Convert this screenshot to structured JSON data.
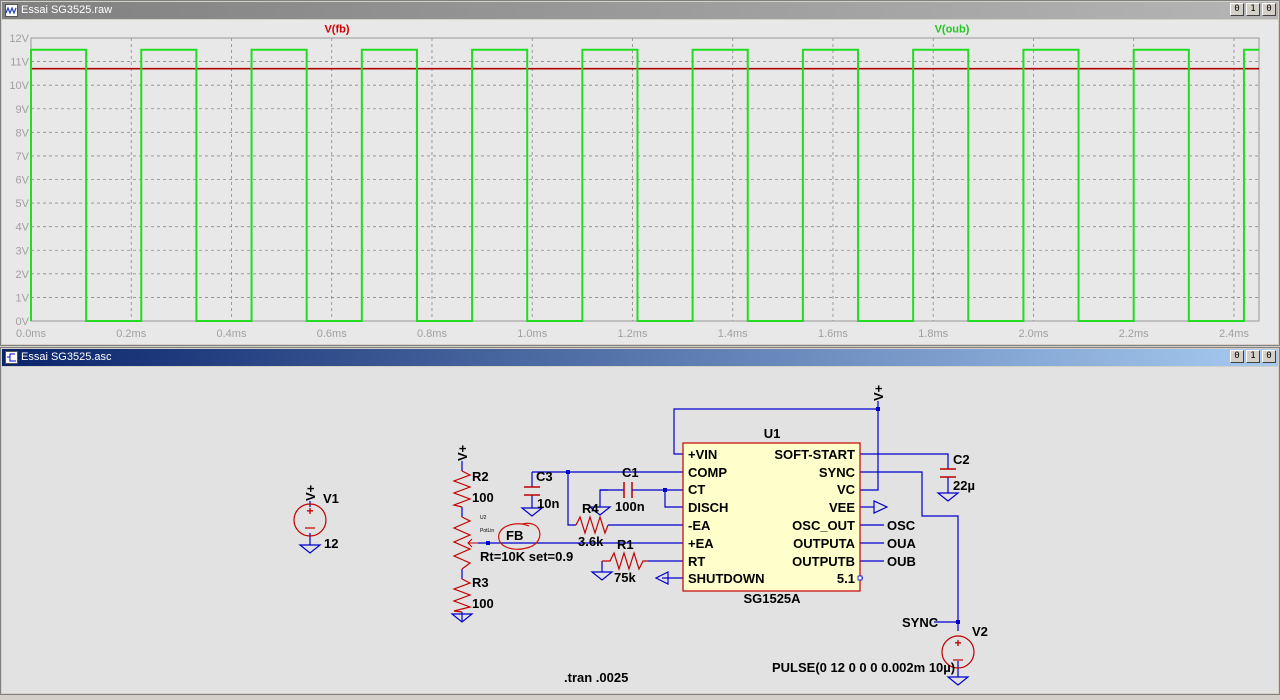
{
  "plot_window": {
    "title": "Essai SG3525.raw",
    "buttons": [
      "0",
      "1",
      "0"
    ],
    "trace_labels": [
      {
        "name": "V(fb)",
        "color": "#d00000"
      },
      {
        "name": "V(oub)",
        "color": "#21dc21"
      }
    ]
  },
  "chart_data": {
    "type": "line",
    "title": "",
    "xlabel": "",
    "ylabel": "",
    "xlim": [
      0.0,
      2.45
    ],
    "x_unit": "ms",
    "ylim": [
      0,
      12
    ],
    "y_unit": "V",
    "grid": true,
    "x_ticks": [
      "0.0ms",
      "0.2ms",
      "0.4ms",
      "0.6ms",
      "0.8ms",
      "1.0ms",
      "1.2ms",
      "1.4ms",
      "1.6ms",
      "1.8ms",
      "2.0ms",
      "2.2ms",
      "2.4ms"
    ],
    "y_ticks": [
      "0V",
      "1V",
      "2V",
      "3V",
      "4V",
      "5V",
      "6V",
      "7V",
      "8V",
      "9V",
      "10V",
      "11V",
      "12V"
    ],
    "series": [
      {
        "name": "V(fb)",
        "color": "#b00000",
        "style": "constant",
        "x": [
          0.0,
          2.45
        ],
        "y": [
          10.7,
          10.7
        ]
      },
      {
        "name": "V(oub)",
        "color": "#21dc21",
        "style": "square-wave",
        "low": 0.0,
        "high": 11.5,
        "high_intervals": [
          [
            0.0,
            0.11
          ],
          [
            0.22,
            0.33
          ],
          [
            0.44,
            0.55
          ],
          [
            0.66,
            0.77
          ],
          [
            0.88,
            0.99
          ],
          [
            1.1,
            1.21
          ],
          [
            1.32,
            1.43
          ],
          [
            1.54,
            1.65
          ],
          [
            1.76,
            1.87
          ],
          [
            1.98,
            2.09
          ],
          [
            2.2,
            2.31
          ],
          [
            2.42,
            2.45
          ]
        ]
      }
    ]
  },
  "schematic_window": {
    "title": "Essai SG3525.asc",
    "buttons": [
      "0",
      "1",
      "0"
    ],
    "ic": {
      "ref": "U1",
      "part": "SG1525A",
      "left_pins": [
        "+VIN",
        "COMP",
        "CT",
        "DISCH",
        "-EA",
        "+EA",
        "RT",
        "SHUTDOWN"
      ],
      "right_pins": [
        "SOFT-START",
        "SYNC",
        "VC",
        "VEE",
        "OSC_OUT",
        "OUTPUTA",
        "OUTPUTB",
        "5.1"
      ]
    },
    "components": {
      "V1": {
        "ref": "V1",
        "value": "12"
      },
      "R2": {
        "ref": "R2",
        "value": "100"
      },
      "R3": {
        "ref": "R3",
        "value": "100"
      },
      "pot": {
        "value": "Rt=10K set=0.9",
        "tiny_label": "PotLin",
        "tiny_ref": "U2"
      },
      "C3": {
        "ref": "C3",
        "value": "10n"
      },
      "C1": {
        "ref": "C1",
        "value": "100n"
      },
      "R4": {
        "ref": "R4",
        "value": "3.6k"
      },
      "R1": {
        "ref": "R1",
        "value": "75k"
      },
      "C2": {
        "ref": "C2",
        "value": "22µ"
      },
      "V2": {
        "ref": "V2",
        "value": "PULSE(0 12 0 0 0 0.002m 10µ)"
      }
    },
    "net_labels": {
      "vplus": "V+",
      "fb": "FB",
      "osc": "OSC",
      "oua": "OUA",
      "oub": "OUB",
      "sync": "SYNC"
    },
    "directive": ".tran .0025"
  },
  "colors": {
    "wire": "#0000cc",
    "component": "#c00000",
    "ic_fill": "#ffffcc",
    "plot_bg": "#e8e8e8"
  }
}
